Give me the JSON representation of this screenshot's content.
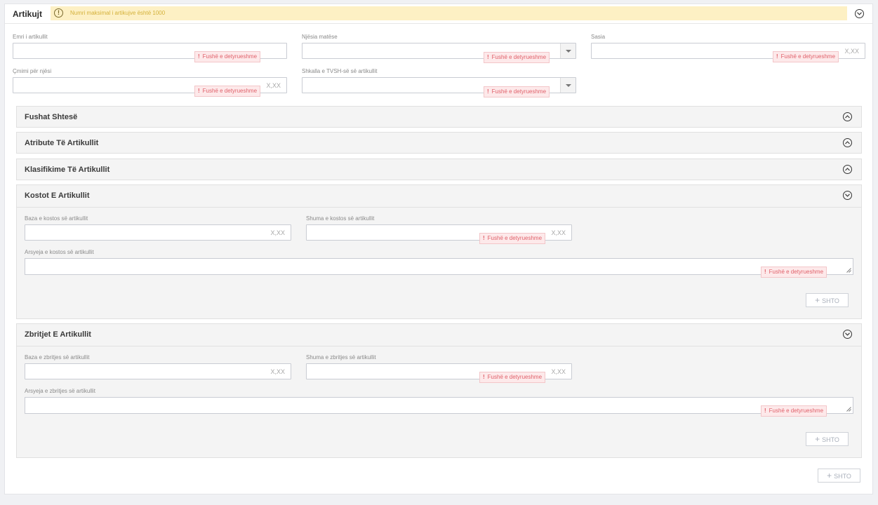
{
  "header": {
    "title": "Artikujt",
    "warning": "Numri maksimal i artikujve është 1000"
  },
  "fields": {
    "name_label": "Emri i artikullit",
    "unit_label": "Njësia matëse",
    "qty_label": "Sasia",
    "price_label": "Çmimi për njësi",
    "vat_label": "Shkalla e TVSH-së së artikullit",
    "required": "Fushë e detyrueshme",
    "decimal_placeholder": "X,XX"
  },
  "sections": {
    "extra": "Fushat Shtesë",
    "attributes": "Atribute Të Artikullit",
    "classifications": "Klasifikime Të Artikullit",
    "costs": {
      "title": "Kostot E Artikullit",
      "base_label": "Baza e kostos së artikullit",
      "amount_label": "Shuma e kostos së artikullit",
      "reason_label": "Arsyeja e kostos së artikullit",
      "add_label": "SHTO"
    },
    "discounts": {
      "title": "Zbritjet E Artikullit",
      "base_label": "Baza e zbritjes së artikullit",
      "amount_label": "Shuma e zbritjes së artikullit",
      "reason_label": "Arsyeja e zbritjes së artikullit",
      "add_label": "SHTO"
    }
  },
  "footer": {
    "add_label": "SHTO"
  },
  "icons": {
    "warning": "warning-circle-icon",
    "collapse": "chevron-circle-icon",
    "plus": "plus-icon"
  },
  "colors": {
    "warning_bg": "#fdf0c4",
    "warning_text": "#d4b13a",
    "error_bg": "#fde9ea",
    "error_text": "#e0606a"
  }
}
